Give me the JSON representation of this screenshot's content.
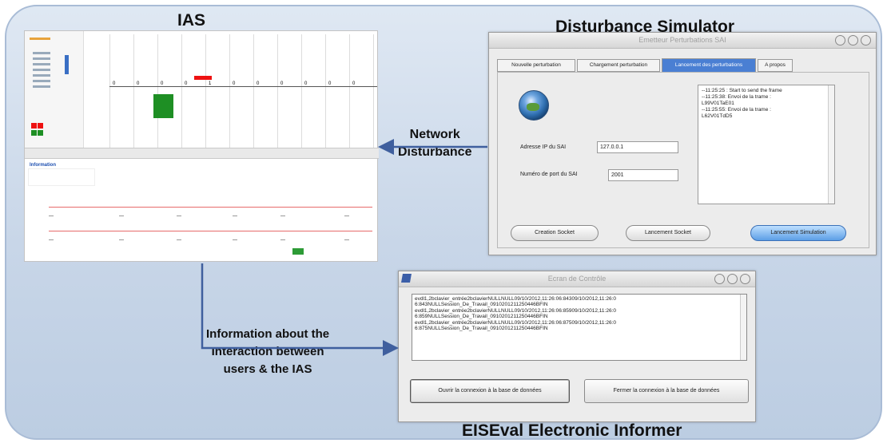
{
  "labels": {
    "ias": "IAS",
    "simulator": "Disturbance Simulator",
    "eiseval": "EISEval Electronic Informer",
    "network_disturbance": [
      "Network",
      "Disturbance"
    ],
    "information_flow": [
      "Information about the",
      "Interaction between",
      "users & the IAS"
    ]
  },
  "ias_screenshot": {
    "info_title": "Information",
    "grid_numbers": [
      "0",
      "0",
      "0",
      "0",
      "1",
      "0",
      "0",
      "0",
      "0",
      "0",
      "0"
    ]
  },
  "simulator_window": {
    "title": "Emetteur Perturbations SAI",
    "tabs": [
      "Nouvelle perturbation",
      "Chargement perturbation",
      "Lancement des perturbations",
      "A propos"
    ],
    "active_tab_index": 2,
    "ip_label": "Adresse IP du SAI",
    "ip_value": "127.0.0.1",
    "port_label": "Numéro de port du SAI",
    "port_value": "2001",
    "log": [
      "--11:25:25 : Start to send the frame",
      "--11:25:38: Envoi de la trame :",
      "L99V01TaE01",
      "--11:25:55: Envoi de la trame :",
      "L62V01TdD5"
    ],
    "buttons": [
      "Creation Socket",
      "Lancement Socket",
      "Lancement Simulation"
    ]
  },
  "eiseval_window": {
    "title": "Ecran de Contrôle",
    "log": [
      "evdl1,2bclavier_entrée2bclavierNULLNULL09/10/2012,11:26:06:84309/10/2012,11:26:0",
      "6:843NULLSession_De_Travail_0910201211250446BFIN",
      "evdl1,2bclavier_entrée2bclavierNULLNULL09/10/2012,11:26:06:85909/10/2012,11:26:0",
      "6:859NULLSession_De_Travail_0910201211250446BFIN",
      "evdl1,2bclavier_entrée2bclavierNULLNULL09/10/2012,11:26:06:87509/10/2012,11:26:0",
      "6:875NULLSession_De_Travail_0910201211250446BFIN"
    ],
    "buttons": [
      "Ouvrir la connexion à la base de données",
      "Fermer la connexion à la base de données"
    ]
  },
  "colors": {
    "panel_bg": "#c8d6e8",
    "arrow": "#3f5f9e",
    "active_tab": "#4a7fd3",
    "ias_red": "#e11111",
    "ias_green": "#1e8f24"
  }
}
